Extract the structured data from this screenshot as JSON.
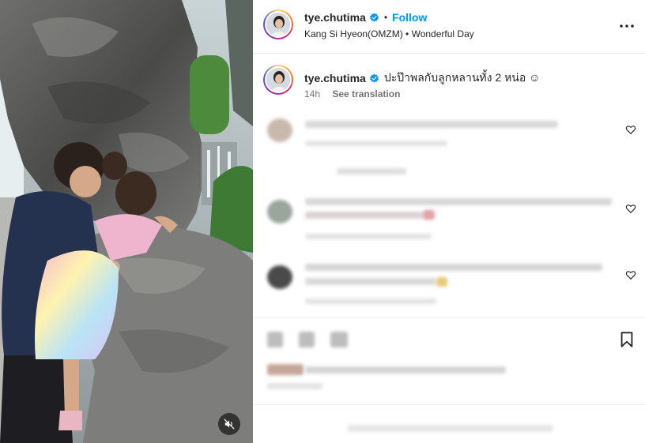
{
  "post": {
    "username": "tye.chutima",
    "follow_label": "Follow",
    "dot": "•",
    "audio": {
      "artist": "Kang Si Hyeon(OMZM)",
      "separator": "•",
      "track": "Wonderful Day"
    }
  },
  "caption": {
    "username": "tye.chutima",
    "text": "ปะป๊าพลกับลูกหลานทั้ง 2 หน่อ ☺",
    "time": "14h",
    "translate_label": "See translation"
  },
  "icons": {
    "verified": "verified-badge-icon",
    "more": "more-options-icon",
    "heart": "heart-outline-icon",
    "bookmark": "bookmark-icon",
    "mute": "audio-muted-icon"
  },
  "colors": {
    "brand_blue": "#0095f6",
    "text": "#262626",
    "muted_text": "#737373",
    "divider": "#efefef"
  }
}
